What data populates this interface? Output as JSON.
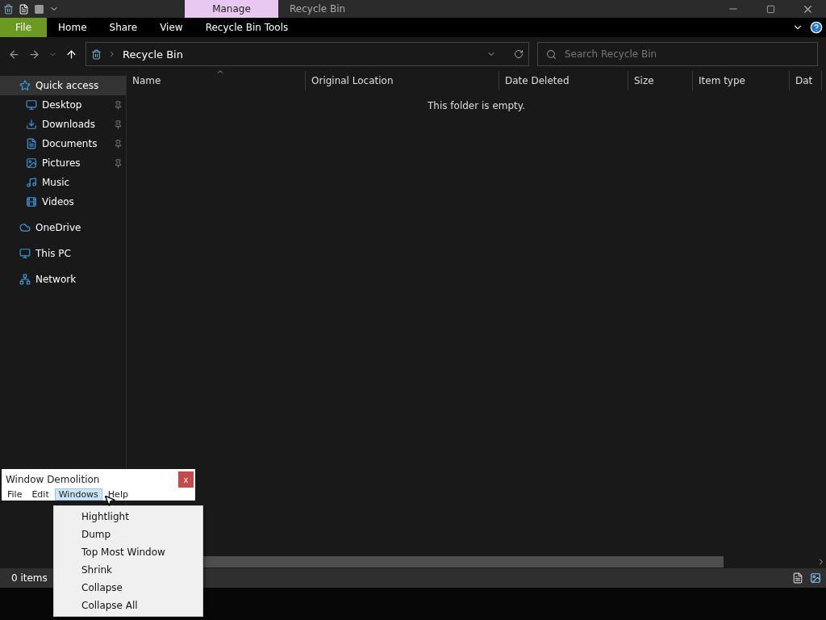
{
  "window": {
    "title": "Recycle Bin",
    "context_tab": "Manage"
  },
  "ribbon_tabs": [
    {
      "label": "File",
      "kind": "file"
    },
    {
      "label": "Home",
      "kind": "tab"
    },
    {
      "label": "Share",
      "kind": "tab"
    },
    {
      "label": "View",
      "kind": "tab"
    },
    {
      "label": "Recycle Bin Tools",
      "kind": "tab"
    }
  ],
  "address": {
    "path": "Recycle Bin"
  },
  "search": {
    "placeholder": "Search Recycle Bin"
  },
  "sidebar": {
    "items": [
      {
        "label": "Quick access",
        "selected": true,
        "children": [
          {
            "label": "Desktop",
            "pinned": true
          },
          {
            "label": "Downloads",
            "pinned": true
          },
          {
            "label": "Documents",
            "pinned": true
          },
          {
            "label": "Pictures",
            "pinned": true
          },
          {
            "label": "Music",
            "pinned": false
          },
          {
            "label": "Videos",
            "pinned": false
          }
        ]
      },
      {
        "label": "OneDrive",
        "selected": false
      },
      {
        "label": "This PC",
        "selected": false
      },
      {
        "label": "Network",
        "selected": false
      }
    ]
  },
  "table": {
    "columns": [
      {
        "label": "Name",
        "sorted": true
      },
      {
        "label": "Original Location",
        "sorted": false
      },
      {
        "label": "Date Deleted",
        "sorted": false
      },
      {
        "label": "Size",
        "sorted": false
      },
      {
        "label": "Item type",
        "sorted": false
      },
      {
        "label": "Dat",
        "sorted": false
      }
    ],
    "empty_message": "This folder is empty."
  },
  "status_bar": {
    "count": "0 items"
  },
  "demolition": {
    "title": "Window Demolition",
    "close": "x",
    "menus": [
      {
        "label": "File",
        "selected": false
      },
      {
        "label": "Edit",
        "selected": false
      },
      {
        "label": "Windows",
        "selected": true
      },
      {
        "label": "Help",
        "selected": false
      }
    ],
    "dropdown": [
      "Hightlight",
      "Dump",
      "Top Most Window",
      "Shrink",
      "Collapse",
      "Collapse All"
    ]
  }
}
